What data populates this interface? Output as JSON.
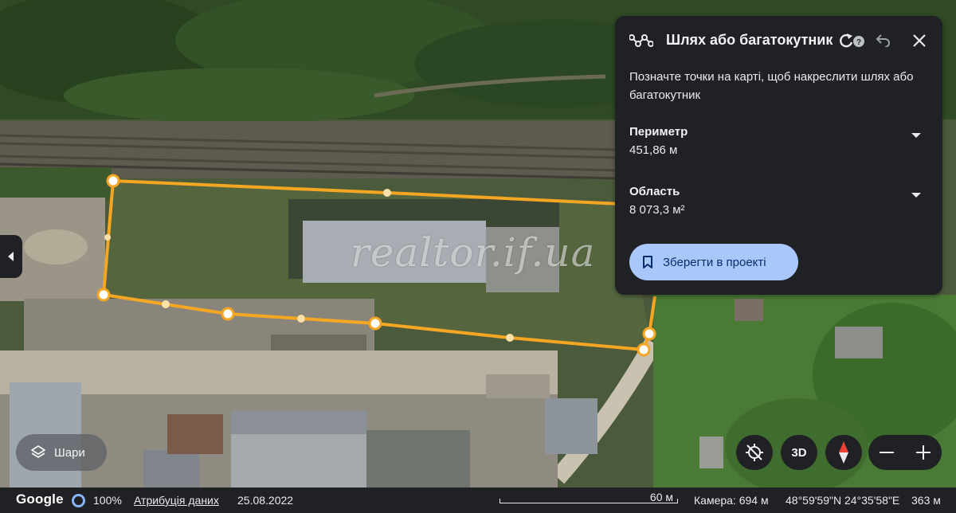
{
  "map": {
    "watermark": "realtor.if.ua"
  },
  "panel": {
    "title": "Шлях або багатокутник",
    "hint": "Позначте точки на карті, щоб накреслити шлях або багатокутник",
    "perimeter_label": "Периметр",
    "perimeter_value": "451,86 м",
    "area_label": "Область",
    "area_value": "8 073,3 м²",
    "save_label": "Зберегти в проекті"
  },
  "layers": {
    "label": "Шари"
  },
  "controls": {
    "mode_3d": "3D",
    "zoom_out": "−",
    "zoom_in": "+"
  },
  "status": {
    "brand": "Google",
    "percent": "100%",
    "attribution": "Атрибуція даних",
    "date": "25.08.2022",
    "scale": "60 м",
    "camera": "Камера: 694 м",
    "coords": "48°59'59\"N 24°35'58\"E",
    "altitude": "363 м"
  },
  "colors": {
    "accent": "#a8c7fa",
    "polygon": "#f5a623",
    "panel_bg": "#202124"
  }
}
